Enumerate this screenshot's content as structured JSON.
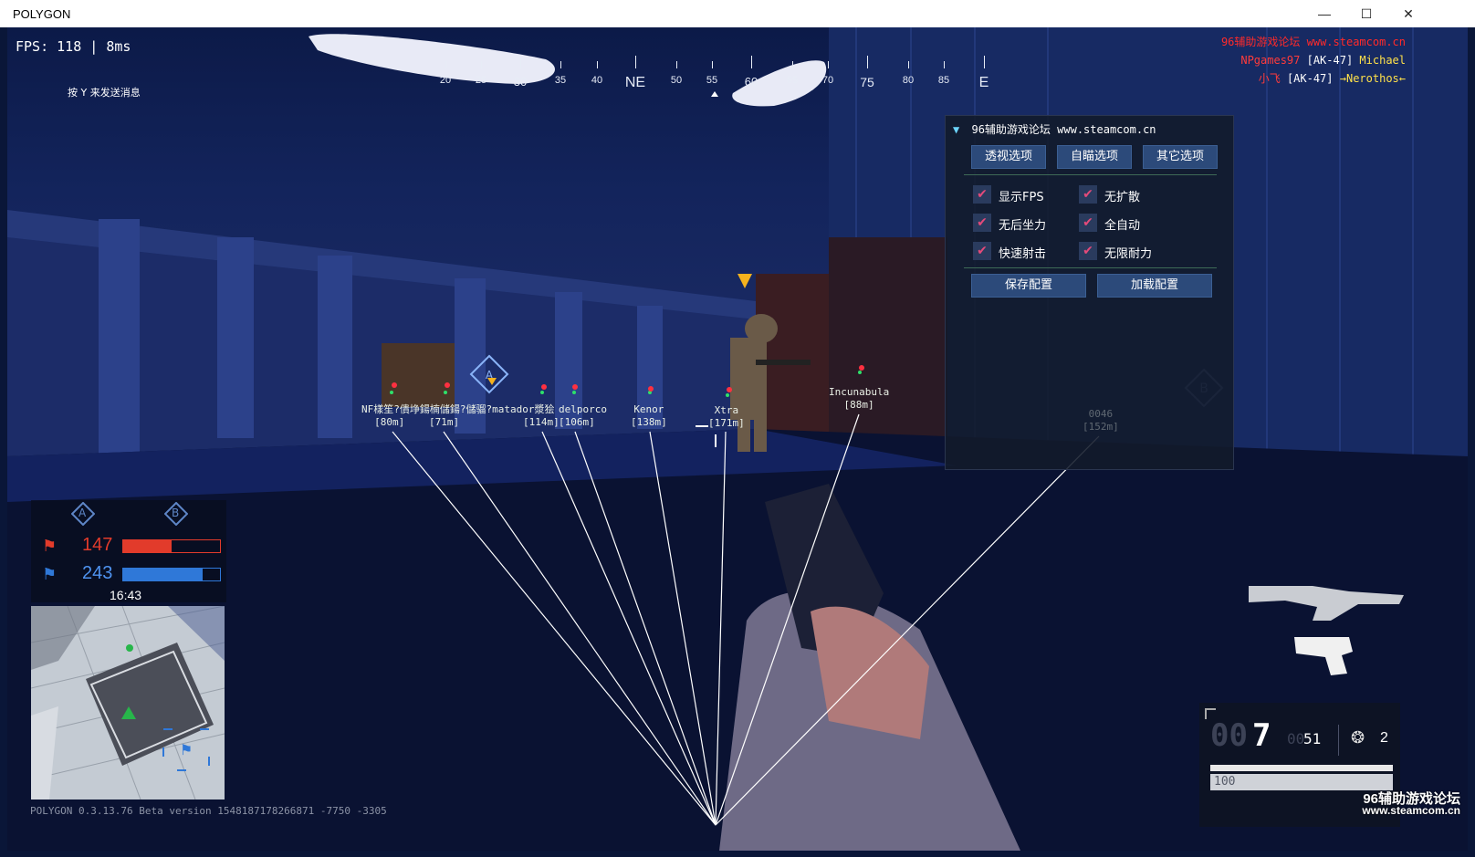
{
  "window": {
    "title": "POLYGON",
    "minimize": "—",
    "maximize": "☐",
    "close": "✕"
  },
  "hud": {
    "fps_label": "FPS: 118 | 8ms",
    "message_hint": "按 Y 来发送消息",
    "version": "POLYGON 0.3.13.76 Beta version 1548187178266871 -7750 -3305"
  },
  "compass": {
    "marks": [
      "20",
      "25",
      "30",
      "35",
      "40",
      "NE",
      "50",
      "55",
      "60",
      "65",
      "70",
      "75",
      "80",
      "85",
      "E"
    ]
  },
  "killfeed": {
    "site": "96辅助游戏论坛 www.steamcom.cn",
    "line1_killer": "NPgames97",
    "line1_weapon": "[AK-47]",
    "line1_victim": "Michael",
    "line2_killer": "小飞",
    "line2_weapon": "[AK-47]",
    "line2_victim": "→Nerothos←"
  },
  "menu": {
    "header": "96辅助游戏论坛 www.steamcom.cn",
    "tabs": [
      "透视选项",
      "自瞄选项",
      "其它选项"
    ],
    "options": [
      {
        "label": "显示FPS",
        "checked": true
      },
      {
        "label": "无扩散",
        "checked": true
      },
      {
        "label": "无后坐力",
        "checked": true
      },
      {
        "label": "全自动",
        "checked": true
      },
      {
        "label": "快速射击",
        "checked": true
      },
      {
        "label": "无限耐力",
        "checked": true
      }
    ],
    "save_label": "保存配置",
    "load_label": "加载配置",
    "check_glyph": "✔"
  },
  "esp": [
    {
      "name": "NF樣笙?僓埩鍚楠儲鍚?儲骝?matador漿狯",
      "dist": "[80m]"
    },
    {
      "name": "",
      "dist": "[71m]"
    },
    {
      "name": "",
      "dist": "[114m]"
    },
    {
      "name": "delporco",
      "dist": "[106m]"
    },
    {
      "name": "Kenor",
      "dist": "[138m]"
    },
    {
      "name": "Xtra",
      "dist": "[171m]"
    },
    {
      "name": "Incunabula",
      "dist": "[88m]"
    },
    {
      "name": "0046",
      "dist": "[152m]"
    }
  ],
  "objectives": {
    "a": "A",
    "b": "B"
  },
  "score": {
    "red": "147",
    "blue": "243",
    "timer": "16:43",
    "red_fill": 0.5,
    "blue_fill": 0.82
  },
  "ammo": {
    "ghost_digits": "00",
    "mag": "7",
    "reserve_ghost": "00",
    "reserve": "51",
    "grenades": "2",
    "health": "100",
    "health_fill": 1.0
  },
  "watermark": {
    "line1": "96辅助游戏论坛",
    "line2": "www.steamcom.cn"
  },
  "colors": {
    "accent_red": "#e23b2b",
    "accent_blue": "#2f78d8",
    "esp_line": "#ffffff",
    "menu_check": "#e44a7a",
    "killfeed_red": "#ff3b3b",
    "killfeed_yellow": "#ffe14a"
  }
}
